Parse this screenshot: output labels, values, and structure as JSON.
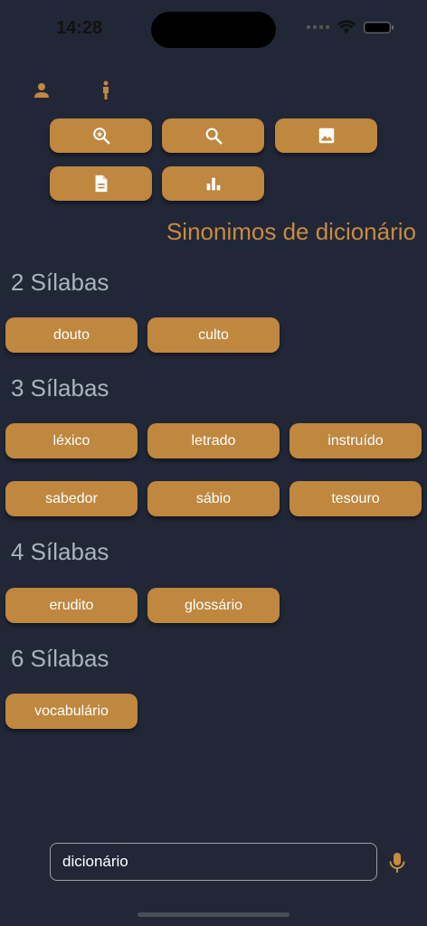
{
  "status_bar": {
    "time": "14:28"
  },
  "toolbar": {
    "mode_icons": [
      "person-icon",
      "standing-person-icon"
    ],
    "buttons": [
      "search-star-icon",
      "search-icon",
      "image-icon",
      "document-icon",
      "bar-chart-icon"
    ]
  },
  "heading": "Sinonimos de dicionário",
  "groups": [
    {
      "title": "2 Sílabas",
      "words": [
        "douto",
        "culto"
      ]
    },
    {
      "title": "3 Sílabas",
      "words": [
        "léxico",
        "letrado",
        "instruído",
        "sabedor",
        "sábio",
        "tesouro"
      ]
    },
    {
      "title": "4 Sílabas",
      "words": [
        "erudito",
        "glossário"
      ]
    },
    {
      "title": "6 Sílabas",
      "words": [
        "vocabulário"
      ]
    }
  ],
  "bottom_bar": {
    "search_value": "dicionário",
    "left_icon": "moon-icon",
    "right_icon": "microphone-icon"
  },
  "colors": {
    "background": "#222737",
    "accent": "#c0873f",
    "heading": "#c98b3f",
    "section_title": "#aab4bc"
  }
}
